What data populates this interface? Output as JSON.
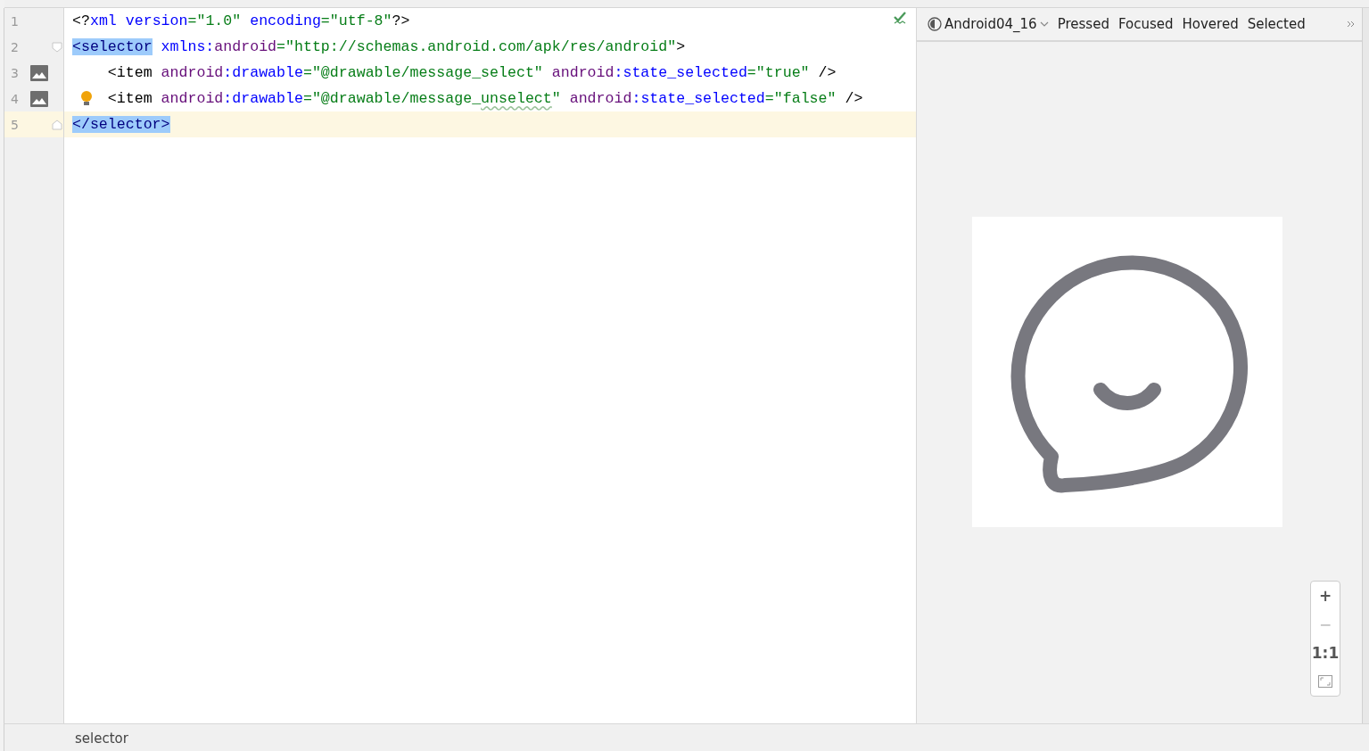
{
  "editor": {
    "lines": [
      {
        "number": "1",
        "current": false,
        "image_icon": false,
        "fold_start": false,
        "fold_end": false,
        "bulb": false,
        "tokens": [
          {
            "t": "<?",
            "kind": "punct"
          },
          {
            "t": "xml version",
            "kind": "attr"
          },
          {
            "t": "=\"1.0\"",
            "kind": "str"
          },
          {
            "t": " encoding",
            "kind": "attr"
          },
          {
            "t": "=\"utf-8\"",
            "kind": "str"
          },
          {
            "t": "?>",
            "kind": "punct"
          }
        ]
      },
      {
        "number": "2",
        "current": false,
        "image_icon": false,
        "fold_start": true,
        "fold_end": false,
        "bulb": false,
        "tokens": [
          {
            "t": "<selector",
            "kind": "tag",
            "highlighted": true
          },
          {
            "t": " xmlns:",
            "kind": "attr"
          },
          {
            "t": "android",
            "kind": "ns"
          },
          {
            "t": "=\"http://schemas.android.com/apk/res/android\"",
            "kind": "str"
          },
          {
            "t": ">",
            "kind": "punct"
          }
        ]
      },
      {
        "number": "3",
        "current": false,
        "image_icon": true,
        "fold_start": false,
        "fold_end": false,
        "bulb": false,
        "tokens": [
          {
            "t": "    <item ",
            "kind": "punct"
          },
          {
            "t": "android",
            "kind": "ns"
          },
          {
            "t": ":drawable",
            "kind": "attr"
          },
          {
            "t": "=\"@drawable/message_select\"",
            "kind": "str"
          },
          {
            "t": " android",
            "kind": "ns"
          },
          {
            "t": ":state_selected",
            "kind": "attr"
          },
          {
            "t": "=\"true\"",
            "kind": "str"
          },
          {
            "t": " />",
            "kind": "punct"
          }
        ]
      },
      {
        "number": "4",
        "current": false,
        "image_icon": true,
        "fold_start": false,
        "fold_end": false,
        "bulb": true,
        "tokens": [
          {
            "t": "    <item ",
            "kind": "punct"
          },
          {
            "t": "android",
            "kind": "ns"
          },
          {
            "t": ":drawable",
            "kind": "attr"
          },
          {
            "t": "=\"@drawable/message_",
            "kind": "str"
          },
          {
            "t": "unselect",
            "kind": "str",
            "misspelled": true
          },
          {
            "t": "\"",
            "kind": "str"
          },
          {
            "t": " android",
            "kind": "ns"
          },
          {
            "t": ":state_selected",
            "kind": "attr"
          },
          {
            "t": "=\"false\"",
            "kind": "str"
          },
          {
            "t": " />",
            "kind": "punct"
          }
        ]
      },
      {
        "number": "5",
        "current": true,
        "image_icon": false,
        "fold_start": false,
        "fold_end": true,
        "bulb": false,
        "tokens": [
          {
            "t": "</selector>",
            "kind": "tag",
            "highlighted": true
          }
        ]
      }
    ]
  },
  "preview": {
    "device": "Android04_16",
    "states": [
      "Pressed",
      "Focused",
      "Hovered",
      "Selected"
    ],
    "zoom_controls": [
      {
        "label": "+",
        "kind": "text",
        "disabled": false
      },
      {
        "label": "−",
        "kind": "text",
        "disabled": true
      },
      {
        "label": "1:1",
        "kind": "text",
        "disabled": false
      },
      {
        "kind": "fit",
        "disabled": false
      }
    ]
  },
  "status_bar": {
    "text": "selector"
  }
}
